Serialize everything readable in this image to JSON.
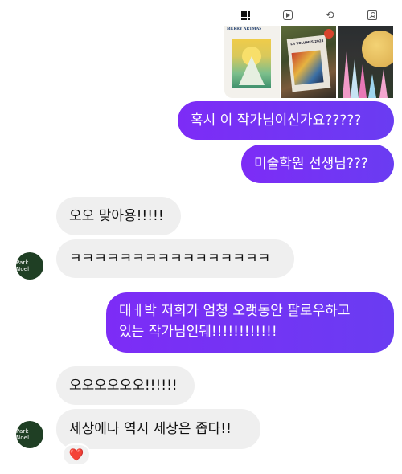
{
  "shared_profile": {
    "tabs": [
      {
        "icon": "grid-icon"
      },
      {
        "icon": "reels-icon"
      },
      {
        "icon": "repost-icon"
      },
      {
        "icon": "tagged-icon"
      }
    ],
    "thumbnail_1": {
      "title": "MERRY ARTMAS",
      "subtitle": "",
      "footer": ""
    },
    "thumbnail_2": {
      "title": "LA VOLUMES 2023"
    }
  },
  "sender": {
    "avatar_text": "Park Noel"
  },
  "messages": [
    {
      "direction": "outgoing",
      "text": "혹시 이 작가님이신가요?????"
    },
    {
      "direction": "outgoing",
      "text": "미술학원 선생님???"
    },
    {
      "direction": "incoming",
      "text": "오오 맞아용!!!!!"
    },
    {
      "direction": "incoming",
      "text": "ㅋㅋㅋㅋㅋㅋㅋㅋㅋㅋㅋㅋㅋㅋㅋㅋ"
    },
    {
      "direction": "outgoing",
      "text_line1": "대ㅔ박 저희가 엄청 오랫동안 팔로우하고",
      "text_line2": "있는 작가님인뒈!!!!!!!!!!!!"
    },
    {
      "direction": "incoming",
      "text": "오오오오오오!!!!!!"
    },
    {
      "direction": "incoming",
      "text": "세상에나 역시 세상은 좁다!!"
    }
  ],
  "reaction": {
    "emoji": "❤️",
    "color": "#e0192e"
  },
  "colors": {
    "outgoing_bubble": "#7b2ff7",
    "incoming_bubble": "#efefef",
    "avatar_bg": "#1f3f24"
  }
}
